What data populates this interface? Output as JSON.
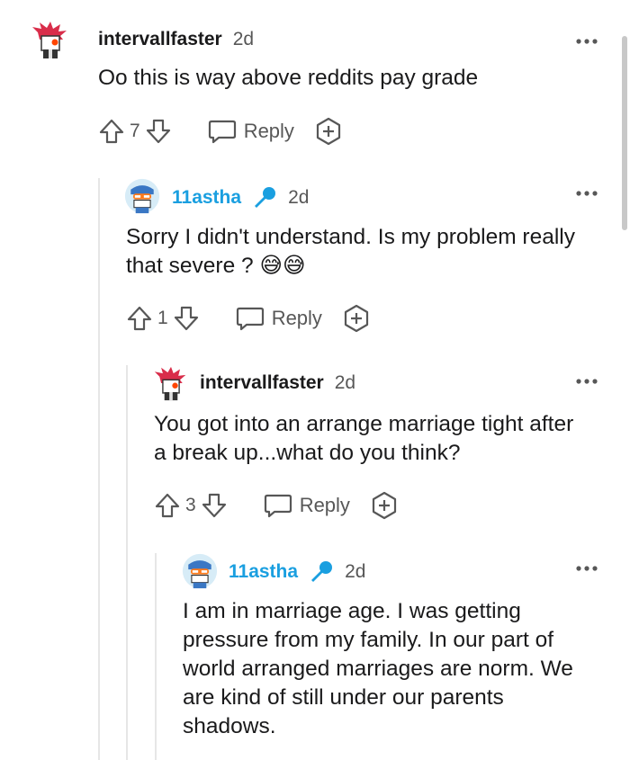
{
  "comments": [
    {
      "username": "intervallfaster",
      "time": "2d",
      "body": "Oo this is way above reddits pay grade",
      "votes": "7",
      "reply": "Reply",
      "is_op": false
    },
    {
      "username": "11astha",
      "time": "2d",
      "body": "Sorry I didn't understand. Is my problem really that severe ? 😅😅",
      "votes": "1",
      "reply": "Reply",
      "is_op": true
    },
    {
      "username": "intervallfaster",
      "time": "2d",
      "body": "You got into an arrange marriage tight after a break up...what do you think?",
      "votes": "3",
      "reply": "Reply",
      "is_op": false
    },
    {
      "username": "11astha",
      "time": "2d",
      "body": "I am in marriage age. I was getting pressure from my family. In our part of world arranged marriages are norm. We are kind of still under our parents shadows.",
      "is_op": true
    }
  ],
  "icons": {
    "upvote": "upvote-arrow-icon",
    "downvote": "downvote-arrow-icon",
    "reply": "speech-bubble-icon",
    "award": "plus-award-icon",
    "more": "three-dots-icon",
    "op_flair": "microphone-icon"
  },
  "colors": {
    "op_username": "#1a9fe0",
    "text": "#1a1a1b",
    "muted": "#575757"
  }
}
